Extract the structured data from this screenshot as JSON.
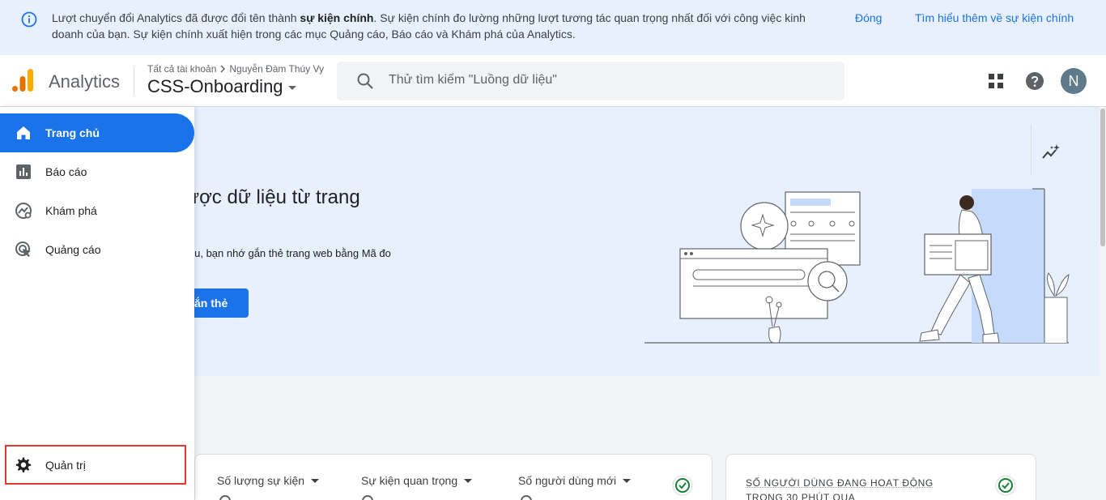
{
  "banner": {
    "text_1": "Lượt chuyển đổi Analytics đã được đổi tên thành ",
    "text_bold": "sự kiện chính",
    "text_2": ". Sự kiện chính đo lường những lượt tương tác quan trọng nhất đối với công việc kinh doanh của bạn. Sự kiện chính xuất hiện trong các mục Quảng cáo, Báo cáo và Khám phá của Analytics.",
    "close_label": "Đóng",
    "learn_more_label": "Tìm hiểu thêm về sự kiện chính"
  },
  "header": {
    "app_name": "Analytics",
    "breadcrumb_root": "Tất cả tài khoản",
    "breadcrumb_account": "Nguyễn Đàm Thúy Vy",
    "property_name": "CSS-Onboarding",
    "search_placeholder": "Thử tìm kiếm \"Luồng dữ liệu\"",
    "avatar_initial": "N"
  },
  "sidebar": {
    "items": [
      {
        "label": "Trang chủ",
        "icon": "home-icon",
        "active": true
      },
      {
        "label": "Báo cáo",
        "icon": "bar-chart-icon",
        "active": false
      },
      {
        "label": "Khám phá",
        "icon": "explore-icon",
        "active": false
      },
      {
        "label": "Quảng cáo",
        "icon": "ads-icon",
        "active": false
      }
    ],
    "admin_label": "Quản trị"
  },
  "hero": {
    "title": "ược dữ liệu từ trang",
    "description": "iệu, bạn nhớ gắn thẻ trang web bằng Mã đo",
    "button_label": "ắn thẻ"
  },
  "cards": {
    "metrics": [
      "Số lượng sự kiện",
      "Sự kiện quan trọng",
      "Số người dùng mới"
    ],
    "realtime_title": "SỐ NGƯỜI DÙNG ĐANG HOẠT ĐỘNG TRONG 30 PHÚT QUA"
  },
  "colors": {
    "accent": "#1a73e8",
    "banner_bg": "#e8f0fe",
    "check_green": "#188038",
    "highlight_border": "#e53935"
  }
}
